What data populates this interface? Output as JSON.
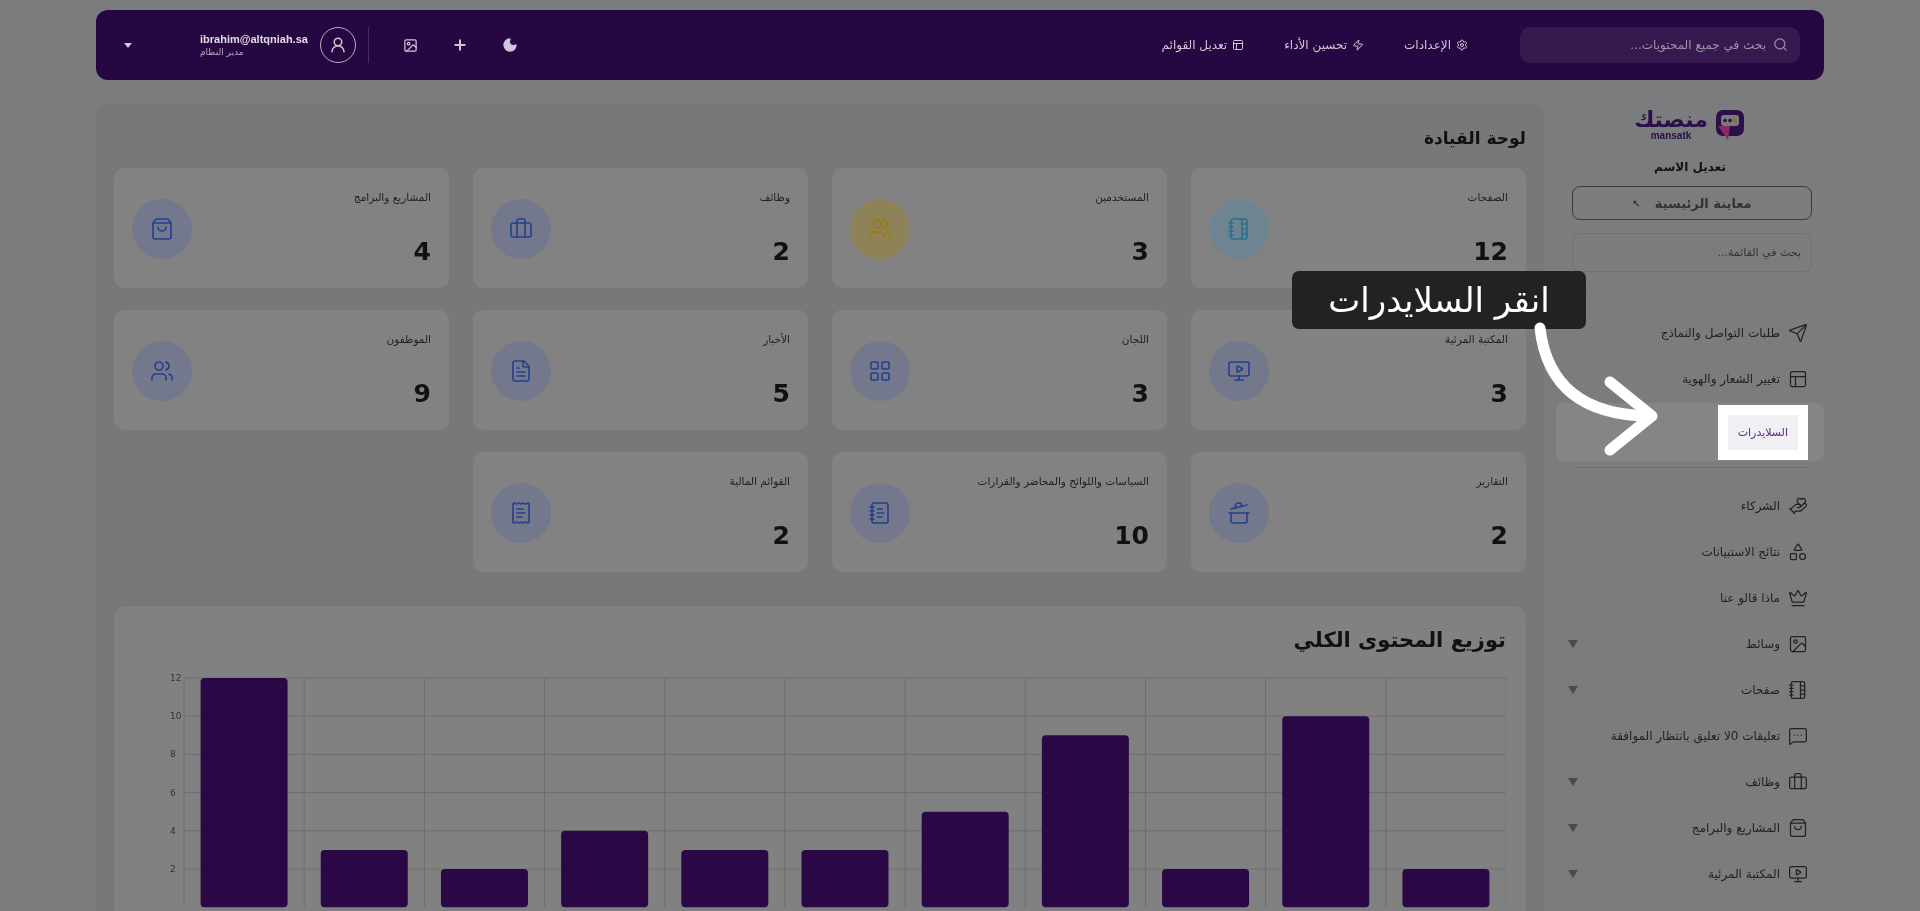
{
  "header": {
    "search": {
      "placeholder": "بحث في جميع المحتويات..."
    },
    "nav": [
      {
        "label": "الإعدادات"
      },
      {
        "label": "تحسين الأداء"
      },
      {
        "label": "تعديل القوائم"
      }
    ],
    "user": {
      "email": "ibrahim@altqniah.sa",
      "role": "مدير النظام"
    }
  },
  "sidebar": {
    "logo": {
      "name": "منصتك",
      "latin": "mansatk"
    },
    "site_name": "تعديل الاسم",
    "preview_button": "معاينة الرئيسية",
    "preview_mark": "↖",
    "search": {
      "placeholder": "بحث في القائمة..."
    },
    "items": [
      {
        "label": "طلبات التواصل والنماذج",
        "kind": "link",
        "selected": false
      },
      {
        "label": "تغيير الشعار والهوية",
        "kind": "link",
        "selected": false
      },
      {
        "label": "السلايدرات",
        "kind": "link",
        "selected": true
      },
      {
        "label": "الشركاء",
        "kind": "link",
        "selected": false
      },
      {
        "label": "نتائج الاستبيانات",
        "kind": "link",
        "selected": false
      },
      {
        "label": "ماذا قالو عنا",
        "kind": "link",
        "selected": false
      },
      {
        "label": "وسائط",
        "kind": "group",
        "selected": false
      },
      {
        "label": "صفحات",
        "kind": "group",
        "selected": false
      },
      {
        "label": "تعليقات 0لا تعليق بانتظار الموافقة",
        "kind": "link",
        "selected": false
      },
      {
        "label": "وظائف",
        "kind": "group",
        "selected": false
      },
      {
        "label": "المشاريع والبرامج",
        "kind": "group",
        "selected": false
      },
      {
        "label": "المكتبة المرئية",
        "kind": "group",
        "selected": false
      }
    ]
  },
  "dashboard": {
    "title": "لوحة القيادة",
    "cards": [
      {
        "label": "الصفحات",
        "value": "12",
        "color": "#6f8491"
      },
      {
        "label": "المستخدمين",
        "value": "3",
        "color": "#8e8358"
      },
      {
        "label": "وظائف",
        "value": "2",
        "color": "#74788c"
      },
      {
        "label": "المشاريع والبرامج",
        "value": "4",
        "color": "#74788c"
      },
      {
        "label": "المكتبة المرئية",
        "value": "3",
        "color": "#74788c"
      },
      {
        "label": "اللجان",
        "value": "3",
        "color": "#74788c"
      },
      {
        "label": "الأخبار",
        "value": "5",
        "color": "#74788c"
      },
      {
        "label": "الموظفون",
        "value": "9",
        "color": "#74788c"
      },
      {
        "label": "التقارير",
        "value": "2",
        "color": "#74788c"
      },
      {
        "label": "السياسات واللوائح والمحاضر والقرارات",
        "value": "10",
        "color": "#74788c"
      },
      {
        "label": "القوائم المالية",
        "value": "2",
        "color": "#74788c"
      }
    ],
    "chart": {
      "chart_data": {
        "type": "bar",
        "title": "توزيع المحتوى الكلي",
        "ylim": [
          0,
          12
        ],
        "yticks": [
          2,
          4,
          6,
          8,
          10,
          12
        ],
        "grid": true,
        "series": [
          {
            "color": "#2a0845",
            "values": [
              12,
              3,
              2,
              4,
              3,
              3,
              5,
              9,
              2,
              10,
              2
            ]
          }
        ]
      }
    }
  },
  "tour": {
    "tip": "انقر السلايدرات"
  }
}
